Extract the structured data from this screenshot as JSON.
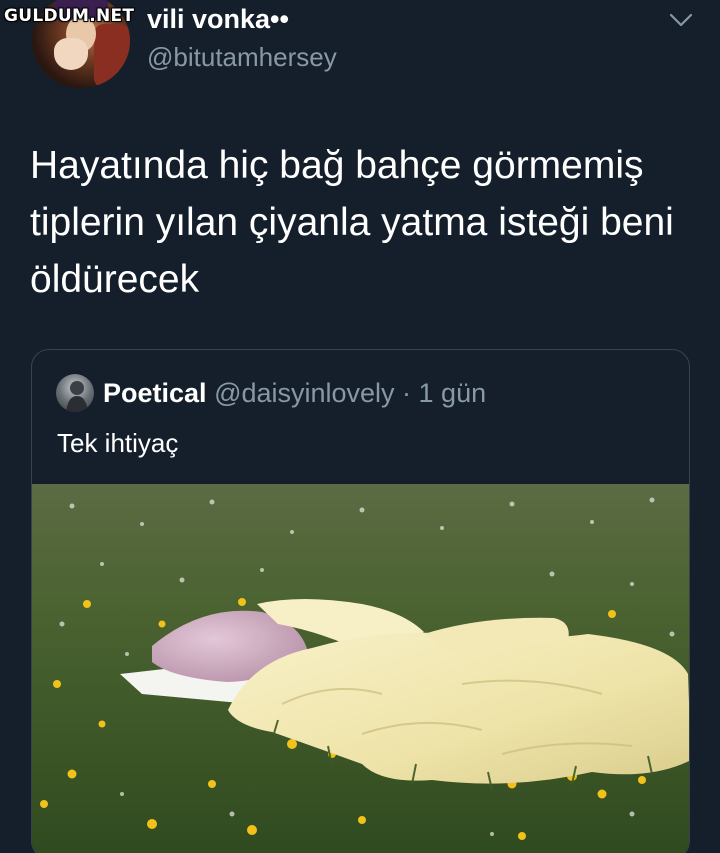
{
  "watermark": "GULDUM.NET",
  "author": {
    "display_name": "vili vonka••",
    "handle": "@bitutamhersey"
  },
  "tweet": {
    "text_lines": [
      "Hayatında hiç bağ bahçe görmemiş",
      "tiplerin yılan çiyanla yatma isteği beni",
      "öldürecek"
    ]
  },
  "quoted": {
    "display_name": "Poetical",
    "handle_time": "@daisyinlovely · 1 gün",
    "text": "Tek ihtiyaç"
  },
  "icons": {
    "menu": "chevron-down-icon"
  },
  "colors": {
    "background": "#151f2b",
    "secondary_text": "#8899a6",
    "border": "#38444d"
  }
}
